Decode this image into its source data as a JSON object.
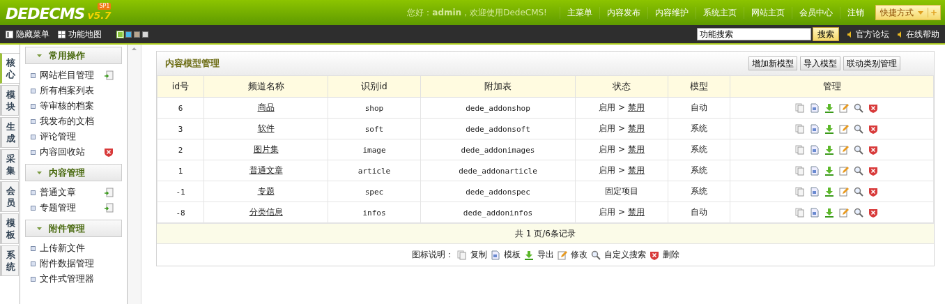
{
  "header": {
    "logo": "DEDECMS",
    "version": "v5.7",
    "edition": "SP1",
    "greeting": "您好：**admin**，欢迎使用DedeCMS!",
    "nav": [
      "主菜单",
      "内容发布",
      "内容维护",
      "系统主页",
      "网站主页",
      "会员中心",
      "注销"
    ],
    "quick_button": "快捷方式",
    "quick_add": "+"
  },
  "toolbar": {
    "hide_menu": "隐藏菜单",
    "site_map": "功能地图",
    "skins": [
      {
        "color": "#8cc63e",
        "selected": true
      },
      {
        "color": "#49b6e8",
        "selected": false
      },
      {
        "color": "#b8a48e",
        "selected": false
      },
      {
        "color": "#d8d8d8",
        "selected": false
      }
    ],
    "search": {
      "value": "功能搜索",
      "button": "搜索"
    },
    "links": [
      "官方论坛",
      "在线帮助"
    ]
  },
  "side_tabs": [
    {
      "label": "核心",
      "selected": true
    },
    {
      "label": "模块",
      "selected": false
    },
    {
      "label": "生成",
      "selected": false
    },
    {
      "label": "采集",
      "selected": false
    },
    {
      "label": "会员",
      "selected": false
    },
    {
      "label": "模板",
      "selected": false
    },
    {
      "label": "系统",
      "selected": false
    }
  ],
  "sidebar": [
    {
      "title": "常用操作",
      "items": [
        {
          "label": "网站栏目管理",
          "kind": "add"
        },
        {
          "label": "所有档案列表"
        },
        {
          "label": "等审核的档案"
        },
        {
          "label": "我发布的文档"
        },
        {
          "label": "评论管理"
        },
        {
          "label": "内容回收站",
          "kind": "delete"
        }
      ]
    },
    {
      "title": "内容管理",
      "items": [
        {
          "label": "普通文章",
          "kind": "add"
        },
        {
          "label": "专题管理",
          "kind": "add"
        }
      ]
    },
    {
      "title": "附件管理",
      "items": [
        {
          "label": "上传新文件"
        },
        {
          "label": "附件数据管理"
        },
        {
          "label": "文件式管理器"
        }
      ]
    }
  ],
  "panel": {
    "title": "内容模型管理",
    "buttons": [
      "增加新模型",
      "导入模型",
      "联动类别管理"
    ],
    "columns": [
      "id号",
      "频道名称",
      "识别id",
      "附加表",
      "状态",
      "模型",
      "管理"
    ],
    "rows": [
      {
        "id": "6",
        "name": "商品",
        "nid": "shop",
        "table": "dede_addonshop",
        "status_text": "启用",
        "status_separator": ">",
        "status_link": "禁用",
        "model": "自动"
      },
      {
        "id": "3",
        "name": "软件",
        "nid": "soft",
        "table": "dede_addonsoft",
        "status_text": "启用",
        "status_separator": ">",
        "status_link": "禁用",
        "model": "系统"
      },
      {
        "id": "2",
        "name": "图片集",
        "nid": "image",
        "table": "dede_addonimages",
        "status_text": "启用",
        "status_separator": ">",
        "status_link": "禁用",
        "model": "系统"
      },
      {
        "id": "1",
        "name": "普通文章",
        "nid": "article",
        "table": "dede_addonarticle",
        "status_text": "启用",
        "status_separator": ">",
        "status_link": "禁用",
        "model": "系统"
      },
      {
        "id": "-1",
        "name": "专题",
        "nid": "spec",
        "table": "dede_addonspec",
        "status_text": "固定项目",
        "model": "系统"
      },
      {
        "id": "-8",
        "name": "分类信息",
        "nid": "infos",
        "table": "dede_addoninfos",
        "status_text": "启用",
        "status_separator": ">",
        "status_link": "禁用",
        "model": "自动"
      }
    ],
    "summary": "共 1 页/6条记录",
    "legend_title": "图标说明：",
    "legend": [
      {
        "kind": "copy",
        "label": "复制"
      },
      {
        "kind": "template",
        "label": "模板"
      },
      {
        "kind": "export",
        "label": "导出"
      },
      {
        "kind": "edit",
        "label": "修改"
      },
      {
        "kind": "search",
        "label": "自定义搜索"
      },
      {
        "kind": "delete",
        "label": "删除"
      }
    ]
  }
}
